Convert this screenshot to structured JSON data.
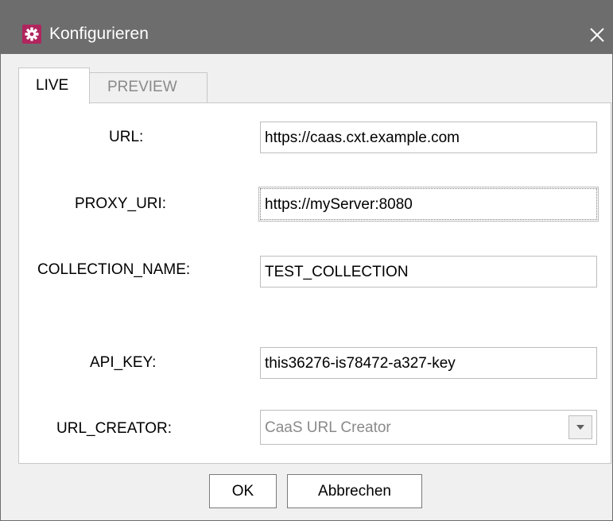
{
  "window": {
    "title": "Konfigurieren",
    "accent_color": "#b0255e",
    "titlebar_color": "#6d6d6d",
    "app_icon": "gear-icon",
    "close_icon": "close-icon"
  },
  "tabs": [
    {
      "label": "LIVE",
      "active": true
    },
    {
      "label": "PREVIEW",
      "active": false
    }
  ],
  "form": {
    "url": {
      "label": "URL:",
      "value": "https://caas.cxt.example.com"
    },
    "proxy_uri": {
      "label": "PROXY_URI:",
      "value": "https://myServer:8080"
    },
    "collection_name": {
      "label": "COLLECTION_NAME:",
      "value": "TEST_COLLECTION"
    },
    "api_key": {
      "label": "API_KEY:",
      "value": "this36276-is78472-a327-key"
    },
    "url_creator": {
      "label": "URL_CREATOR:",
      "selected": "CaaS URL Creator",
      "icon": "chevron-down-icon"
    }
  },
  "buttons": {
    "ok": "OK",
    "cancel": "Abbrechen"
  }
}
